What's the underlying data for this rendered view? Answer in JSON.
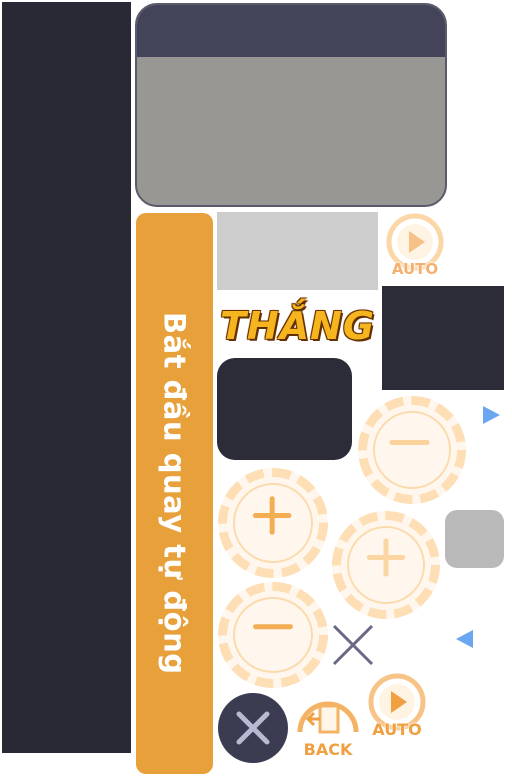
{
  "auto_spin_label": "Bắt đầu quay tự động",
  "win_label": "THẮNG",
  "auto_top": {
    "label": "AUTO",
    "icon": "play-icon"
  },
  "auto_bottom": {
    "label": "AUTO",
    "icon": "play-icon"
  },
  "back_button": {
    "label": "BACK",
    "icon": "exit-door-icon"
  },
  "colors": {
    "orange": "#e7a03a",
    "dark": "#2c2c38",
    "accent_blue": "#5b9cf0"
  }
}
